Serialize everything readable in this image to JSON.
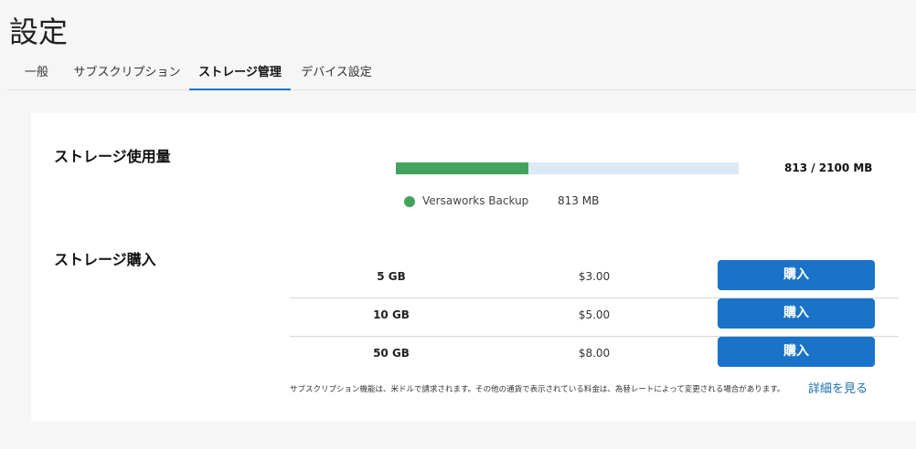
{
  "page": {
    "title": "設定"
  },
  "tabs": [
    {
      "label": "一般",
      "active": false
    },
    {
      "label": "サブスクリプション",
      "active": false
    },
    {
      "label": "ストレージ管理",
      "active": true
    },
    {
      "label": "デバイス設定",
      "active": false
    }
  ],
  "usage": {
    "title": "ストレージ使用量",
    "used_mb": 813,
    "total_mb": 2100,
    "total_text": "813 / 2100 MB",
    "legend": {
      "name": "Versaworks Backup",
      "size": "813 MB",
      "color": "#43a35c"
    },
    "track_color": "#dbe9f5"
  },
  "purchase": {
    "title": "ストレージ購入",
    "plans": [
      {
        "size": "5 GB",
        "price": "$3.00",
        "button": "購入"
      },
      {
        "size": "10 GB",
        "price": "$5.00",
        "button": "購入"
      },
      {
        "size": "50 GB",
        "price": "$8.00",
        "button": "購入"
      }
    ],
    "note": "サブスクリプション機能は、米ドルで請求されます。その他の通貨で表示されている料金は、為替レートによって変更される場合があります。",
    "details_link": "詳細を見る"
  },
  "colors": {
    "accent": "#1a73c8",
    "usage_fill": "#43a35c"
  }
}
